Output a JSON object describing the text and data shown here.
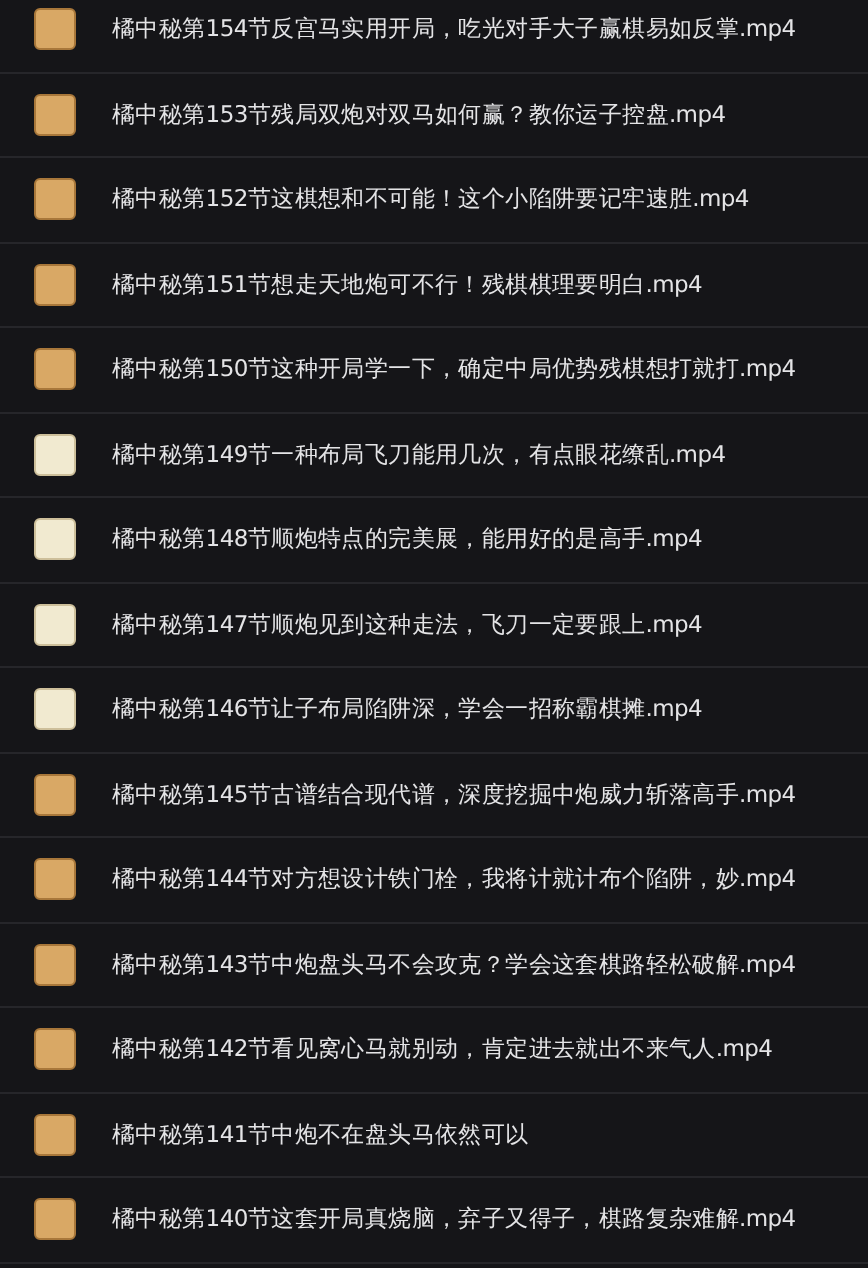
{
  "files": [
    {
      "name": "橘中秘第154节反宫马实用开局，吃光对手大子赢棋易如反掌.mp4",
      "kind": "tan"
    },
    {
      "name": "橘中秘第153节残局双炮对双马如何赢？教你运子控盘.mp4",
      "kind": "tan"
    },
    {
      "name": "橘中秘第152节这棋想和不可能！这个小陷阱要记牢速胜.mp4",
      "kind": "tan"
    },
    {
      "name": "橘中秘第151节想走天地炮可不行！残棋棋理要明白.mp4",
      "kind": "tan"
    },
    {
      "name": "橘中秘第150节这种开局学一下，确定中局优势残棋想打就打.mp4",
      "kind": "tan"
    },
    {
      "name": "橘中秘第149节一种布局飞刀能用几次，有点眼花缭乱.mp4",
      "kind": "cream"
    },
    {
      "name": "橘中秘第148节顺炮特点的完美展，能用好的是高手.mp4",
      "kind": "cream"
    },
    {
      "name": "橘中秘第147节顺炮见到这种走法，飞刀一定要跟上.mp4",
      "kind": "cream"
    },
    {
      "name": "橘中秘第146节让子布局陷阱深，学会一招称霸棋摊.mp4",
      "kind": "cream"
    },
    {
      "name": "橘中秘第145节古谱结合现代谱，深度挖掘中炮威力斩落高手.mp4",
      "kind": "tan"
    },
    {
      "name": "橘中秘第144节对方想设计铁门栓，我将计就计布个陷阱，妙.mp4",
      "kind": "tan"
    },
    {
      "name": "橘中秘第143节中炮盘头马不会攻克？学会这套棋路轻松破解.mp4",
      "kind": "tan"
    },
    {
      "name": "橘中秘第142节看见窝心马就别动，肯定进去就出不来气人.mp4",
      "kind": "tan"
    },
    {
      "name": "橘中秘第141节中炮不在盘头马依然可以",
      "kind": "tan"
    },
    {
      "name": "橘中秘第140节这套开局真烧脑，弃子又得子，棋路复杂难解.mp4",
      "kind": "tan"
    }
  ]
}
